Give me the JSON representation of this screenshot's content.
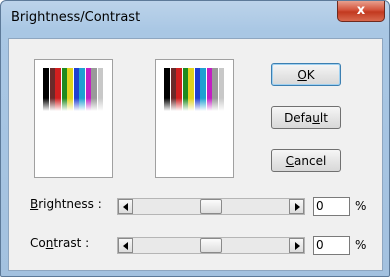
{
  "window": {
    "title": "Brightness/Contrast",
    "close_label": "x"
  },
  "preview": {
    "stripe_colors": [
      "#000000",
      "#6a2a2a",
      "#d21f1f",
      "#1f8a1f",
      "#e0d21e",
      "#1f3fd2",
      "#1fa0d2",
      "#c21fc2",
      "#9a9a9a",
      "#c8c8c8"
    ]
  },
  "buttons": {
    "ok": {
      "pre": "",
      "key": "O",
      "post": "K"
    },
    "default": {
      "pre": "Defa",
      "key": "u",
      "post": "lt"
    },
    "cancel": {
      "pre": "",
      "key": "C",
      "post": "ancel"
    }
  },
  "brightness": {
    "label_key": "B",
    "label_rest": "rightness :",
    "value": "0",
    "unit": "%",
    "level": 0.5
  },
  "contrast": {
    "label_pre": "Co",
    "label_key": "n",
    "label_rest": "trast    :",
    "value": "0",
    "unit": "%",
    "level": 0.5
  }
}
